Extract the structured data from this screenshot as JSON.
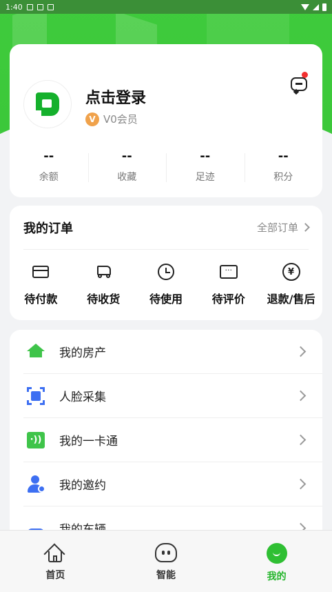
{
  "status_bar": {
    "time": "1:40"
  },
  "profile": {
    "login_label": "点击登录",
    "vip_badge": "V",
    "vip_label": "V0会员",
    "stats": [
      {
        "value": "--",
        "label": "余额"
      },
      {
        "value": "--",
        "label": "收藏"
      },
      {
        "value": "--",
        "label": "足迹"
      },
      {
        "value": "--",
        "label": "积分"
      }
    ]
  },
  "orders": {
    "title": "我的订单",
    "all_label": "全部订单",
    "items": [
      {
        "label": "待付款",
        "icon": "card-icon"
      },
      {
        "label": "待收货",
        "icon": "truck-icon"
      },
      {
        "label": "待使用",
        "icon": "clock-icon"
      },
      {
        "label": "待评价",
        "icon": "comment-icon",
        "glyph": "···"
      },
      {
        "label": "退款/售后",
        "icon": "refund-icon",
        "glyph": "¥"
      }
    ]
  },
  "menu": {
    "items": [
      {
        "label": "我的房产",
        "icon": "house-icon"
      },
      {
        "label": "人脸采集",
        "icon": "face-scan-icon"
      },
      {
        "label": "我的一卡通",
        "icon": "nfc-card-icon",
        "glyph": "·))"
      },
      {
        "label": "我的邀约",
        "icon": "invite-person-icon"
      },
      {
        "label": "我的车辆",
        "icon": "car-icon"
      }
    ]
  },
  "bottom_nav": {
    "items": [
      {
        "label": "首页",
        "icon": "home-icon",
        "active": false
      },
      {
        "label": "智能",
        "icon": "robot-icon",
        "active": false
      },
      {
        "label": "我的",
        "icon": "profile-icon",
        "active": true
      }
    ]
  },
  "colors": {
    "brand_green": "#3fcb3c",
    "active_green": "#25b52c",
    "accent_blue": "#3d6ff2",
    "notification_red": "#f23030",
    "vip_orange": "#f0a24b"
  }
}
